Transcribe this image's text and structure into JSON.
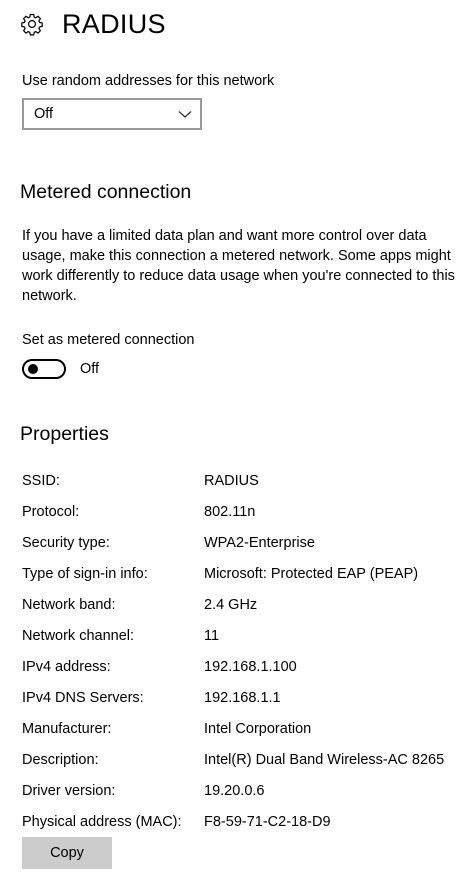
{
  "header": {
    "title": "RADIUS",
    "icon": "gear-icon"
  },
  "random_addresses": {
    "label": "Use random addresses for this network",
    "selected": "Off"
  },
  "metered": {
    "heading": "Metered connection",
    "description": "If you have a limited data plan and want more control over data usage, make this connection a metered network. Some apps might work differently to reduce data usage when you're connected to this network.",
    "toggle_label": "Set as metered connection",
    "toggle_state": "Off",
    "toggle_on": false
  },
  "properties": {
    "heading": "Properties",
    "rows": [
      {
        "key": "SSID:",
        "value": "RADIUS"
      },
      {
        "key": "Protocol:",
        "value": "802.11n"
      },
      {
        "key": "Security type:",
        "value": "WPA2-Enterprise"
      },
      {
        "key": "Type of sign-in info:",
        "value": "Microsoft: Protected EAP (PEAP)"
      },
      {
        "key": "Network band:",
        "value": "2.4 GHz"
      },
      {
        "key": "Network channel:",
        "value": "11"
      },
      {
        "key": "IPv4 address:",
        "value": "192.168.1.100"
      },
      {
        "key": "IPv4 DNS Servers:",
        "value": "192.168.1.1"
      },
      {
        "key": "Manufacturer:",
        "value": "Intel Corporation"
      },
      {
        "key": "Description:",
        "value": "Intel(R) Dual Band Wireless-AC 8265"
      },
      {
        "key": "Driver version:",
        "value": "19.20.0.6"
      },
      {
        "key": "Physical address (MAC):",
        "value": "F8-59-71-C2-18-D9"
      }
    ],
    "copy_label": "Copy"
  }
}
